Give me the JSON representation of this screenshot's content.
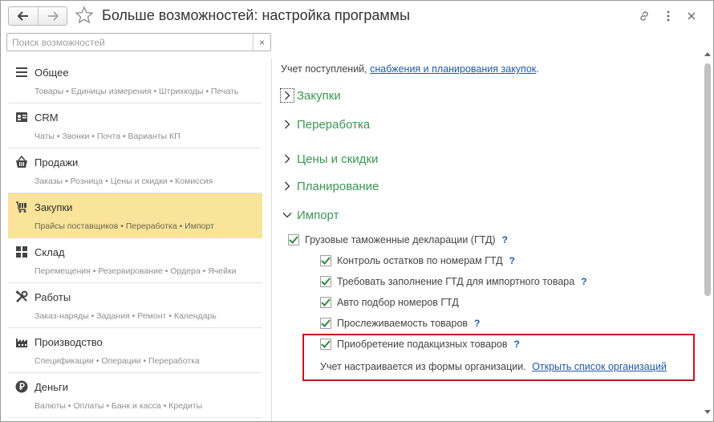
{
  "window": {
    "title": "Больше возможностей: настройка программы"
  },
  "search": {
    "placeholder": "Поиск возможностей",
    "value": "",
    "clear": "×"
  },
  "sidebar": {
    "items": [
      {
        "icon": "list-icon",
        "label": "Общее",
        "sub": "Товары • Единицы измерения • Штрихкоды • Печать",
        "selected": false
      },
      {
        "icon": "crm-card-icon",
        "label": "CRM",
        "sub": "Чаты • Звонки • Почта • Варианты КП",
        "selected": false
      },
      {
        "icon": "basket-icon",
        "label": "Продажи",
        "sub": "Заказы • Розница • Цены и скидки • Комиссия",
        "selected": false
      },
      {
        "icon": "cart-icon",
        "label": "Закупки",
        "sub": "Прайсы поставщиков • Переработка • Импорт",
        "selected": true
      },
      {
        "icon": "warehouse-icon",
        "label": "Склад",
        "sub": "Перемещения • Резервирование • Ордера • Ячейки",
        "selected": false
      },
      {
        "icon": "tools-icon",
        "label": "Работы",
        "sub": "Заказ-наряды • Задания • Ремонт • Календарь",
        "selected": false
      },
      {
        "icon": "factory-icon",
        "label": "Производство",
        "sub": "Спецификации • Операции • Переработка",
        "selected": false
      },
      {
        "icon": "ruble-icon",
        "label": "Деньги",
        "sub": "Валюты • Оплаты • Банк и касса • Кредиты",
        "selected": false
      }
    ]
  },
  "main": {
    "intro_text": "Учет поступлений, ",
    "intro_link": "снабжения и планирования закупок",
    "intro_end": ".",
    "sections": [
      {
        "label": "Закупки",
        "expanded": false
      },
      {
        "label": "Переработка",
        "expanded": false
      },
      {
        "label": "Цены и скидки",
        "expanded": false
      },
      {
        "label": "Планирование",
        "expanded": false
      },
      {
        "label": "Импорт",
        "expanded": true
      }
    ],
    "import_options": {
      "gtd": {
        "label": "Грузовые таможенные декларации (ГТД)",
        "checked": true,
        "help": "?"
      },
      "sub": [
        {
          "label": "Контроль остатков по номерам ГТД",
          "checked": true,
          "help": "?"
        },
        {
          "label": "Требовать заполнение ГТД для импортного товара",
          "checked": true,
          "help": "?"
        },
        {
          "label": "Авто подбор номеров ГТД",
          "checked": true,
          "help": ""
        },
        {
          "label": "Прослеживаемость товаров",
          "checked": true,
          "help": "?"
        },
        {
          "label": "Приобретение подакцизных товаров",
          "checked": true,
          "help": "?"
        }
      ]
    },
    "note_text": "Учет настраивается из формы организации.",
    "note_link": "Открыть список организаций"
  },
  "colors": {
    "selected_bg": "#fae39a",
    "section_green": "#3c9655",
    "link_blue": "#1f5ba8",
    "highlight_red": "#c8141e"
  }
}
